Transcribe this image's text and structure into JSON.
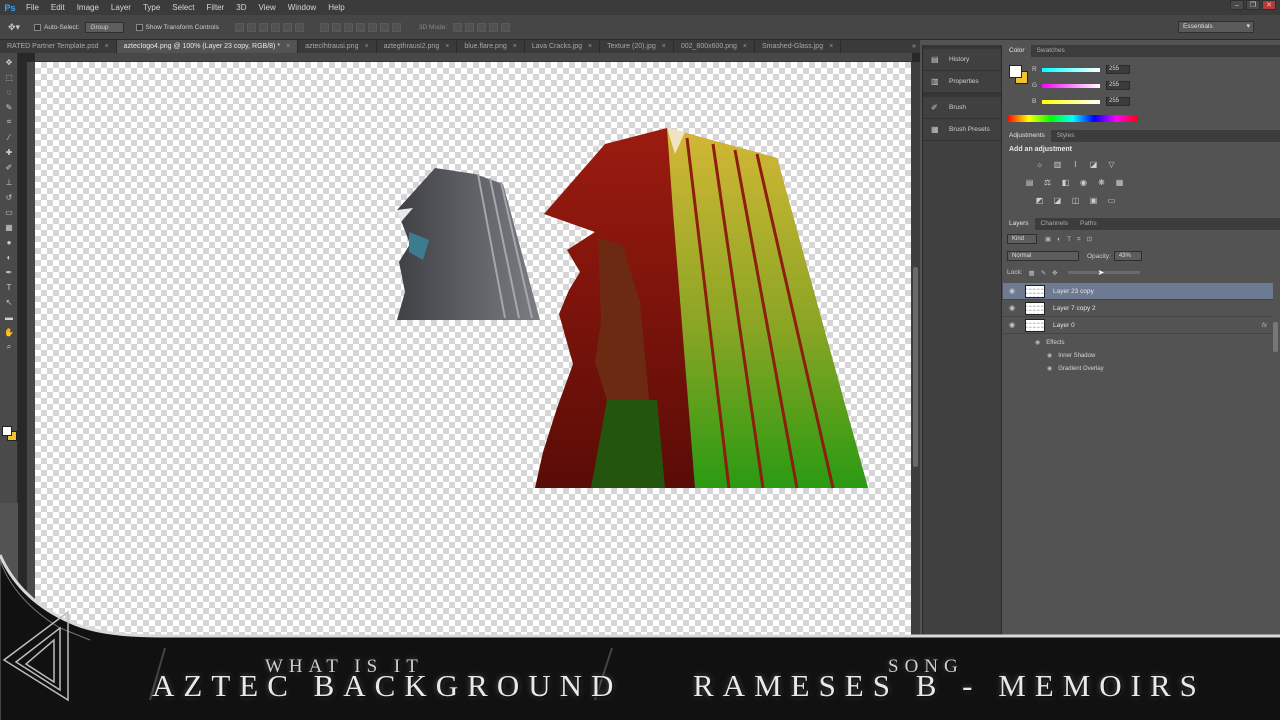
{
  "menubar": {
    "logo": "Ps",
    "items": [
      "File",
      "Edit",
      "Image",
      "Layer",
      "Type",
      "Select",
      "Filter",
      "3D",
      "View",
      "Window",
      "Help"
    ]
  },
  "options": {
    "auto_select": "Auto-Select:",
    "group_value": "Group",
    "show_transform": "Show Transform Controls",
    "mode3d": "3D Mode:",
    "workspace": "Essentials"
  },
  "tabs": [
    "RATED Partner Template.psd",
    "aztecIogo4.png @ 100% (Layer 23 copy, RGB/8) *",
    "aztecIhtrausi.png",
    "aztegthrausi2.png",
    "blue.flare.png",
    "Lava Cracks.jpg",
    "Texture (20).jpg",
    "002_800x600.png",
    "Smashed-Glass.jpg"
  ],
  "dock": {
    "items": [
      "History",
      "Properties",
      "Brush",
      "Brush Presets"
    ]
  },
  "color_panel": {
    "tabs": [
      "Color",
      "Swatches"
    ],
    "r": "255",
    "g": "255",
    "b": "255",
    "r_label": "R",
    "g_label": "G",
    "b_label": "B",
    "fg_color": "#ffffff",
    "bg_color": "#f1c232"
  },
  "adjustments": {
    "tabs": [
      "Adjustments",
      "Styles"
    ],
    "title": "Add an adjustment"
  },
  "layers_panel": {
    "tabs": [
      "Layers",
      "Channels",
      "Paths"
    ],
    "kind": "Kind",
    "blend_mode": "Normal",
    "opacity_label": "Opacity:",
    "opacity_value": "43%",
    "lock_label": "Lock:",
    "layers": [
      "Layer 23 copy",
      "Layer 7 copy 2",
      "Layer 0"
    ],
    "fx_symbol": "fx",
    "effects_label": "Effects",
    "effects": [
      "Inner Shadow",
      "Gradient Overlay"
    ]
  },
  "overlay": {
    "left_small": "What is it",
    "left_big": "Aztec Background",
    "right_small": "Song",
    "right_big": "Rameses B - Memoirs"
  }
}
